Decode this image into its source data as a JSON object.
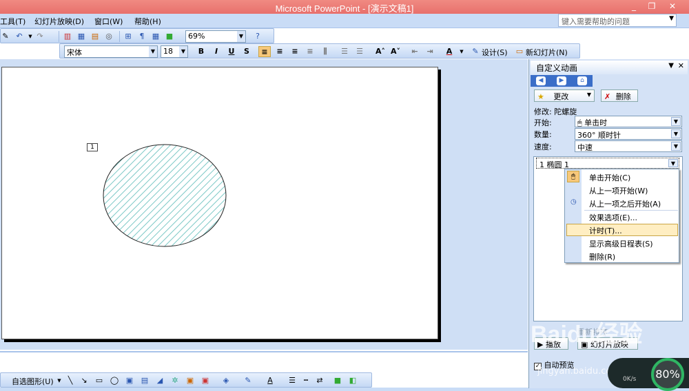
{
  "app": {
    "title": "Microsoft PowerPoint - [演示文稿1]"
  },
  "window_buttons": {
    "minimize": "_",
    "restore": "❐",
    "close": "✕"
  },
  "menubar": {
    "items": [
      "工具(T)",
      "幻灯片放映(D)",
      "窗口(W)",
      "帮助(H)"
    ],
    "help_placeholder": "键入需要帮助的问题"
  },
  "standard_toolbar": {
    "zoom": "69%"
  },
  "format_toolbar": {
    "font": "宋体",
    "size": "18",
    "bold": "B",
    "italic": "I",
    "underline": "U",
    "shadow": "S",
    "design_label": "设计(S)",
    "new_slide_label": "新幻灯片(N)"
  },
  "slide": {
    "animation_tag": "1"
  },
  "draw_toolbar": {
    "autoshapes_label": "自选图形(U)"
  },
  "task_pane": {
    "title": "自定义动画",
    "change_button": "更改",
    "delete_button": "删除",
    "modify_label": "修改: 陀螺旋",
    "start_label": "开始:",
    "start_value": "单击时",
    "amount_label": "数量:",
    "amount_value": "360° 顺时针",
    "speed_label": "速度:",
    "speed_value": "中速",
    "list_item": "1  椭圆 1",
    "reorder_label": "重新排序",
    "play_label": "播放",
    "slideshow_label": "幻灯片放映",
    "autopreview_label": "自动预览"
  },
  "context_menu": {
    "items": [
      "单击开始(C)",
      "从上一项开始(W)",
      "从上一项之后开始(A)",
      "效果选项(E)...",
      "计时(T)...",
      "显示高级日程表(S)",
      "删除(R)"
    ],
    "highlighted_index": 4
  },
  "watermark": {
    "brand": "Baidu经验",
    "url": "jingyan.baidu.com"
  },
  "speed_widget": {
    "rate": "0K/s",
    "percent": "80%"
  },
  "colors": {
    "title_bar": "#e8706c",
    "menubar": "#c9dcf6",
    "hatch": "#7cc8c6",
    "highlight": "#ffeec2"
  }
}
